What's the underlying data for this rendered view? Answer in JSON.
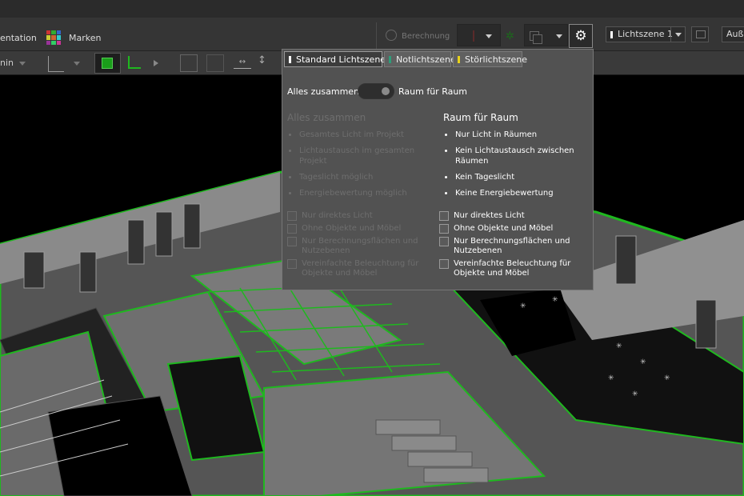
{
  "toolbar": {
    "presentation_label": "entation",
    "marker_label": "Marken",
    "calculation_label": "Berechnung",
    "light_scene_label": "Lichtszene 1",
    "outside_label": "Auße",
    "gear_glyph": "⚙"
  },
  "toolbar2": {
    "left_label": "nin"
  },
  "panel": {
    "tabs": [
      {
        "label": "Standard Lichtszenen",
        "color": "#ffffff",
        "active": true
      },
      {
        "label": "Notlichtszene",
        "color": "#2e9e7a",
        "active": false
      },
      {
        "label": "Störlichtszene",
        "color": "#e8d21a",
        "active": false
      }
    ],
    "toggle": {
      "left_label": "Alles zusammen",
      "right_label": "Raum für Raum",
      "selected": "Raum für Raum"
    },
    "left_column": {
      "title": "Alles zusammen",
      "bullets": [
        "Gesamtes Licht im Projekt",
        "Lichtaustausch im gesamten Projekt",
        "Tageslicht möglich",
        "Energiebewertung möglich"
      ],
      "checkboxes": [
        "Nur direktes Licht",
        "Ohne Objekte und Möbel",
        "Nur Berechnungsflächen und Nutzebenen",
        "Vereinfachte Beleuchtung für Objekte und Möbel"
      ]
    },
    "right_column": {
      "title": "Raum für Raum",
      "bullets": [
        "Nur Licht in Räumen",
        "Kein Lichtaustausch zwischen Räumen",
        "Kein Tageslicht",
        "Keine Energiebewertung"
      ],
      "checkboxes": [
        "Nur direktes Licht",
        "Ohne Objekte und Möbel",
        "Nur Berechnungsflächen und Nutzebenen",
        "Vereinfachte Beleuchtung für Objekte und Möbel"
      ]
    }
  },
  "colors": {
    "accent_green": "#1fb81f",
    "panel_bg": "#525252",
    "toolbar_bg": "#353535"
  }
}
